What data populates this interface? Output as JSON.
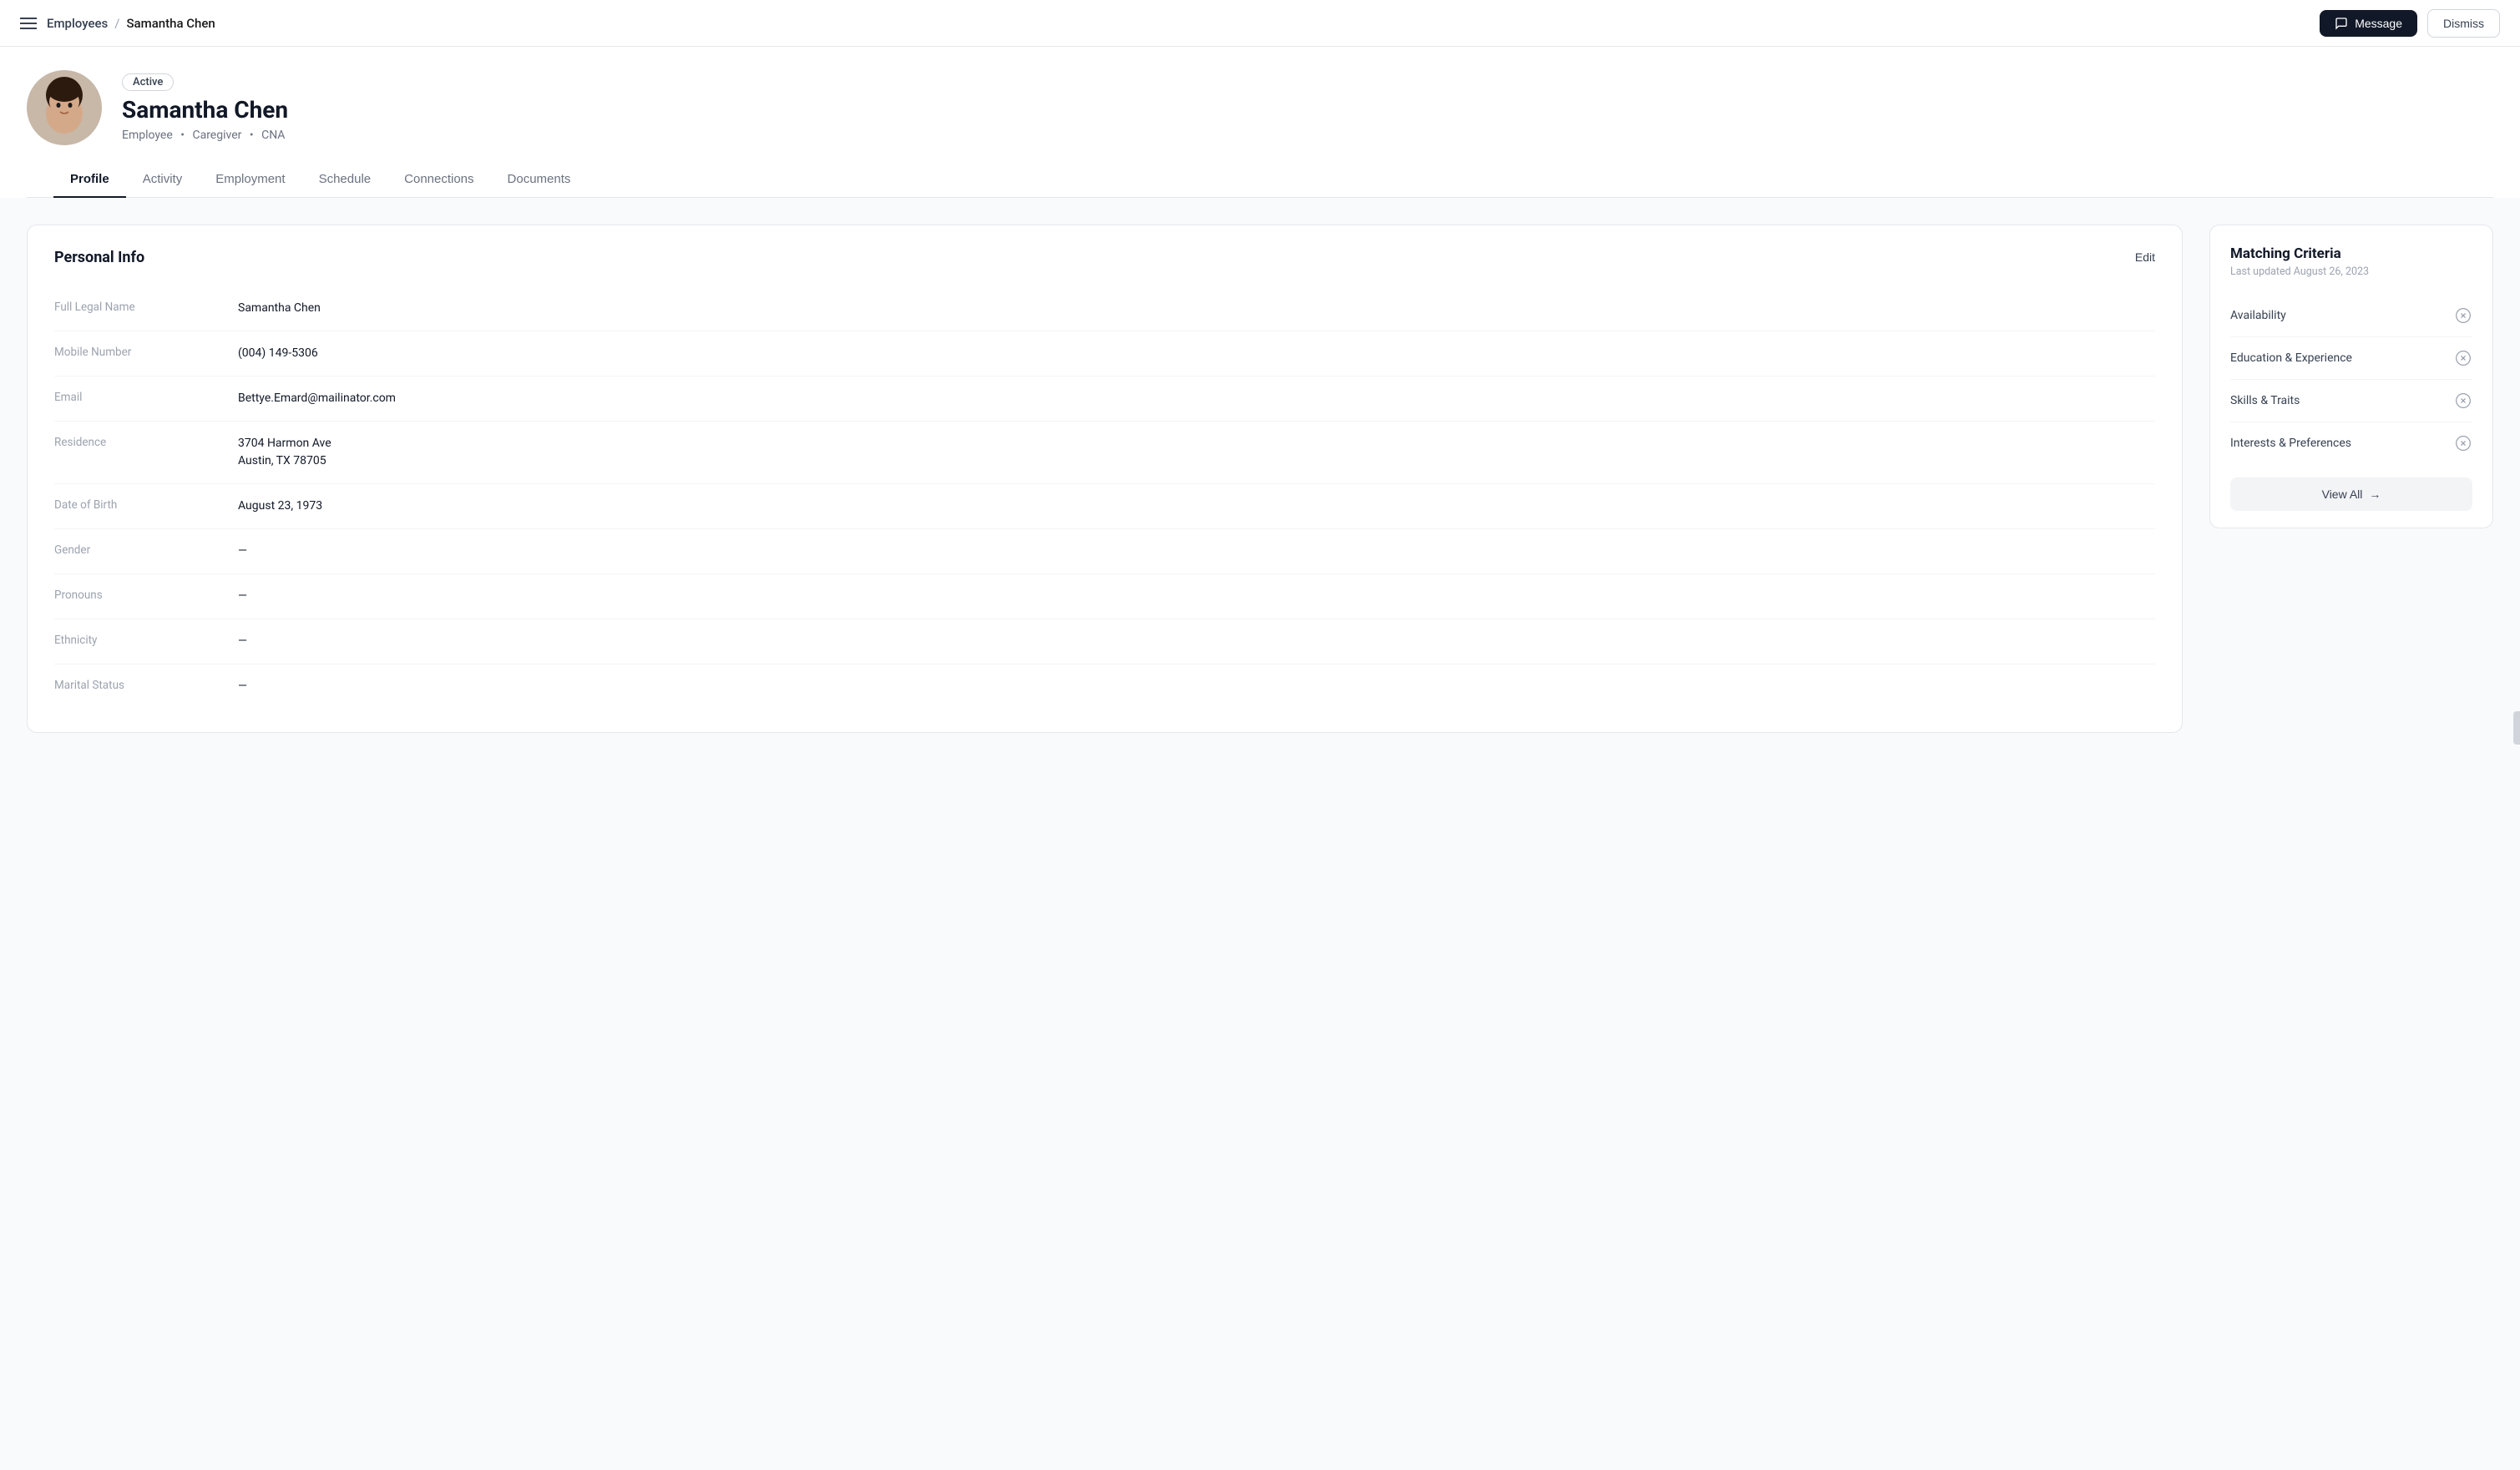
{
  "nav": {
    "menu_icon": "menu-icon",
    "breadcrumb": {
      "parent": "Employees",
      "separator": "/",
      "current": "Samantha Chen"
    },
    "message_btn": "Message",
    "dismiss_btn": "Dismiss"
  },
  "profile": {
    "status": "Active",
    "name": "Samantha Chen",
    "roles": [
      "Employee",
      "Caregiver",
      "CNA"
    ]
  },
  "tabs": [
    {
      "id": "profile",
      "label": "Profile",
      "active": true
    },
    {
      "id": "activity",
      "label": "Activity",
      "active": false
    },
    {
      "id": "employment",
      "label": "Employment",
      "active": false
    },
    {
      "id": "schedule",
      "label": "Schedule",
      "active": false
    },
    {
      "id": "connections",
      "label": "Connections",
      "active": false
    },
    {
      "id": "documents",
      "label": "Documents",
      "active": false
    }
  ],
  "personal_info": {
    "section_title": "Personal Info",
    "edit_label": "Edit",
    "fields": [
      {
        "label": "Full Legal Name",
        "value": "Samantha Chen"
      },
      {
        "label": "Mobile Number",
        "value": "(004) 149-5306"
      },
      {
        "label": "Email",
        "value": "Bettye.Emard@mailinator.com"
      },
      {
        "label": "Residence",
        "value": "3704 Harmon Ave\nAustin, TX 78705"
      },
      {
        "label": "Date of Birth",
        "value": "August 23, 1973"
      },
      {
        "label": "Gender",
        "value": "—"
      },
      {
        "label": "Pronouns",
        "value": "—"
      },
      {
        "label": "Ethnicity",
        "value": "—"
      },
      {
        "label": "Marital Status",
        "value": "—"
      }
    ]
  },
  "matching_criteria": {
    "title": "Matching Criteria",
    "last_updated": "Last updated August 26, 2023",
    "criteria": [
      {
        "label": "Availability"
      },
      {
        "label": "Education & Experience"
      },
      {
        "label": "Skills & Traits"
      },
      {
        "label": "Interests & Preferences"
      }
    ],
    "view_all_label": "View All",
    "arrow": "→"
  }
}
